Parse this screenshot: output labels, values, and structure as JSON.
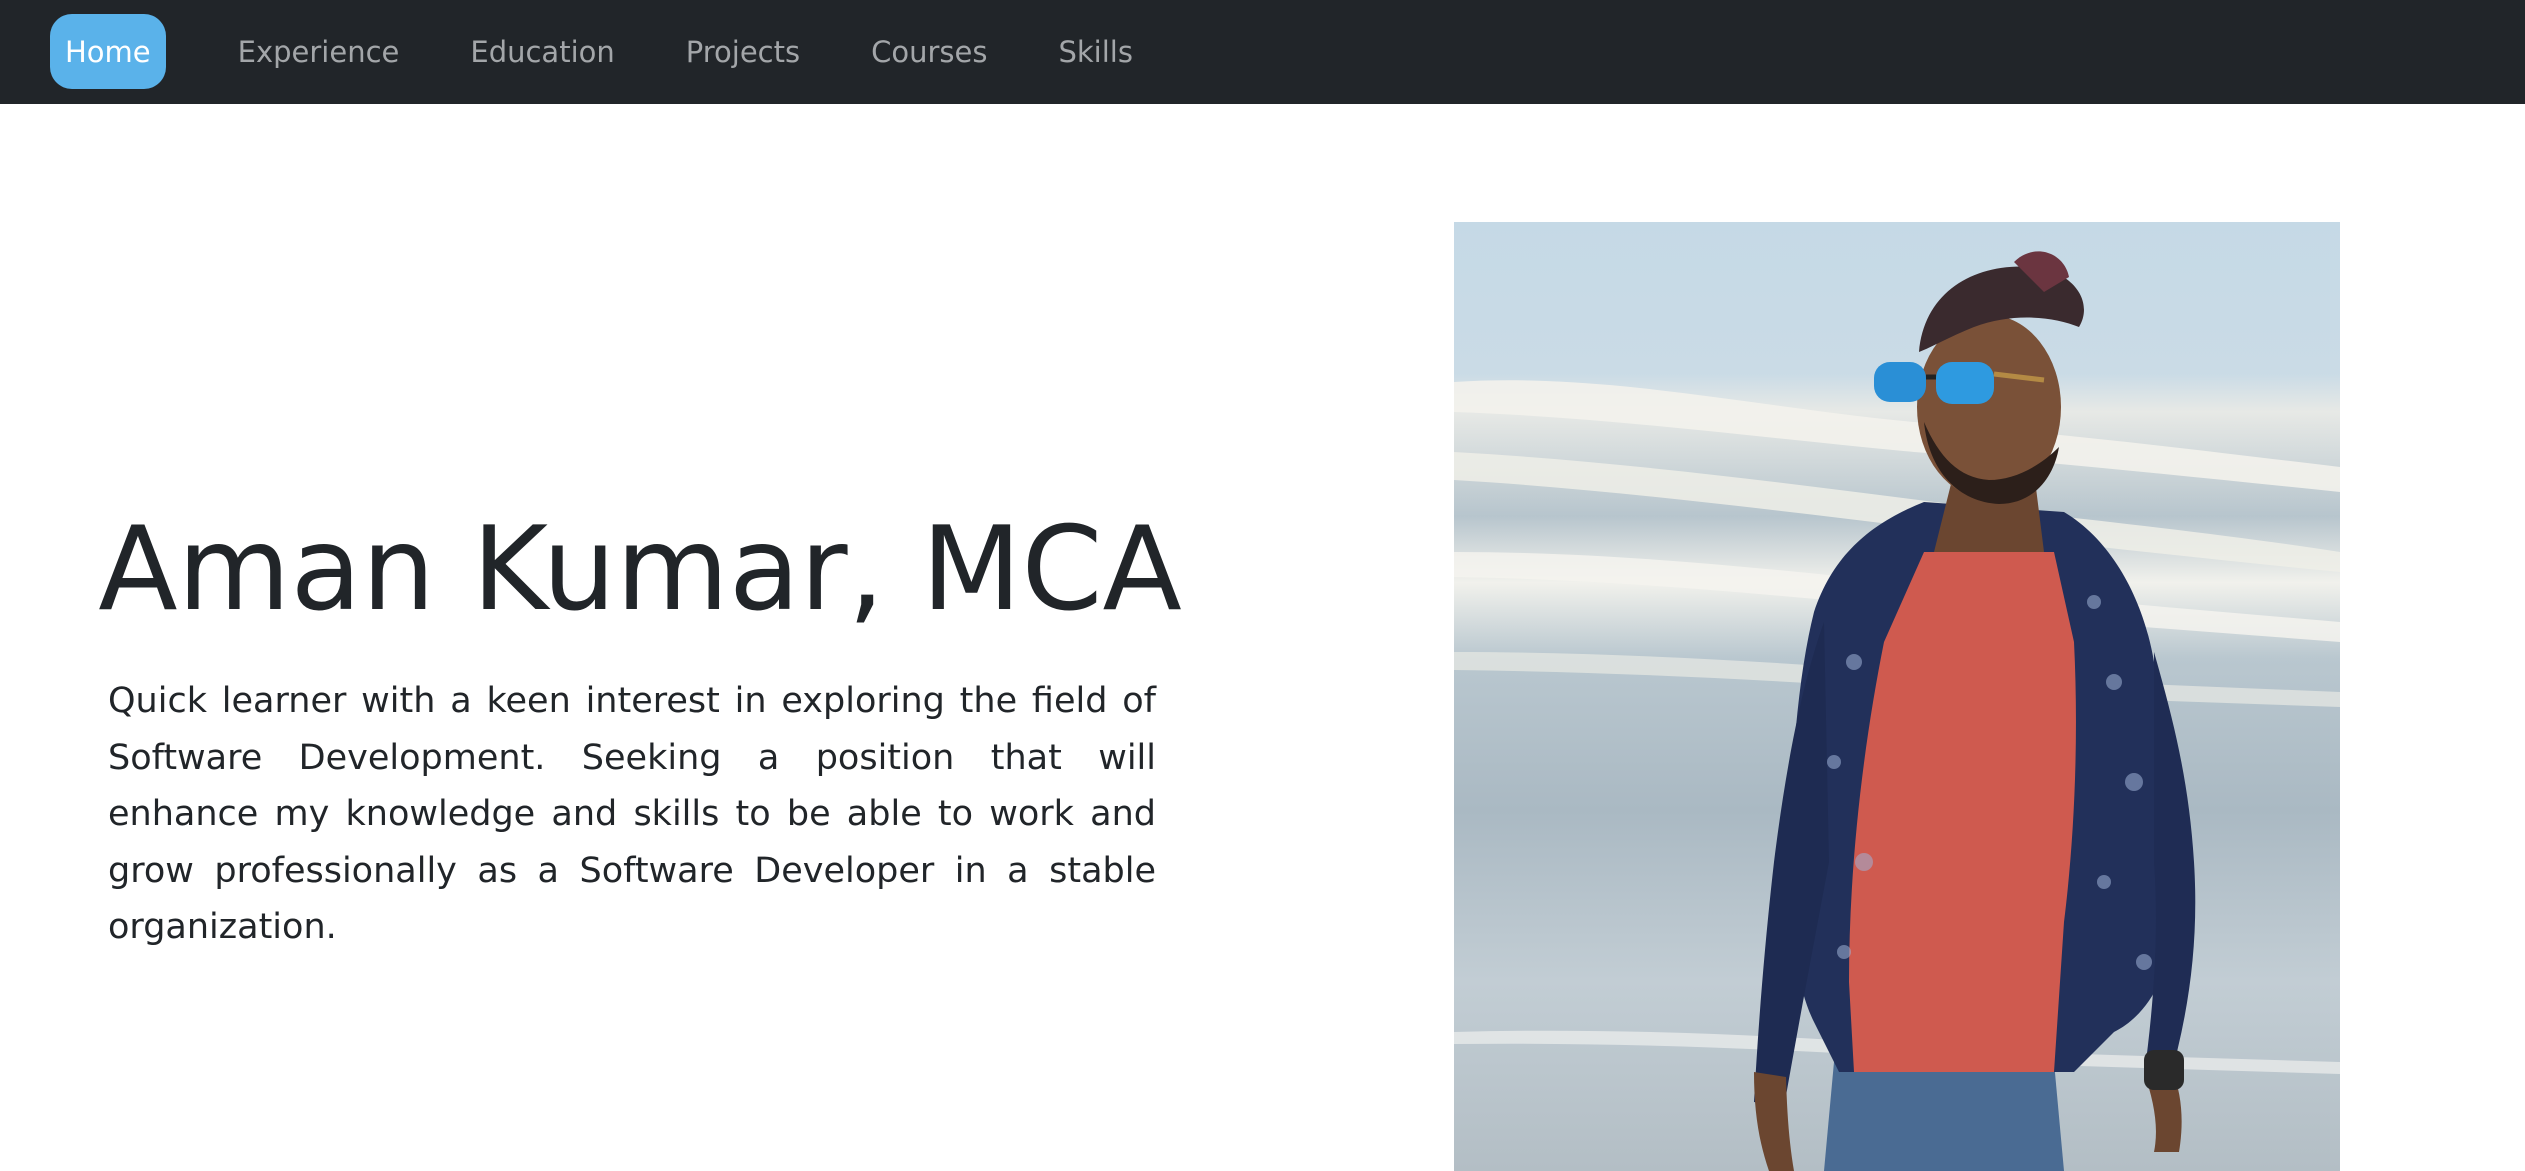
{
  "nav": {
    "items": [
      {
        "label": "Home",
        "active": true
      },
      {
        "label": "Experience",
        "active": false
      },
      {
        "label": "Education",
        "active": false
      },
      {
        "label": "Projects",
        "active": false
      },
      {
        "label": "Courses",
        "active": false
      },
      {
        "label": "Skills",
        "active": false
      }
    ]
  },
  "hero": {
    "name": "Aman Kumar, MCA",
    "summary": "Quick learner with a keen interest in exploring the field of Software Development. Seeking a position that will enhance my knowledge and skills to be able to work and grow professionally as a Software Developer in a stable organization."
  },
  "colors": {
    "navbar_bg": "#212529",
    "nav_active_bg": "#5ab2ea",
    "nav_text": "#a3a6a9",
    "text": "#212529"
  }
}
